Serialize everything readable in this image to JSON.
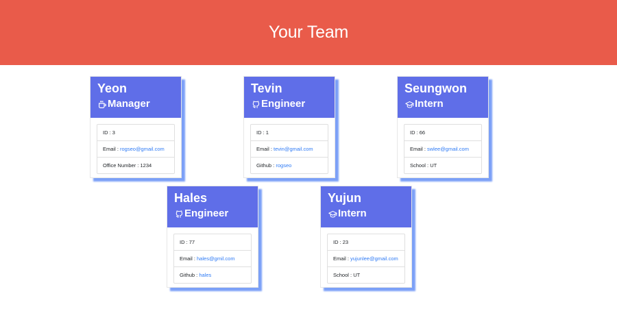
{
  "header": {
    "title": "Your Team"
  },
  "cards": [
    {
      "name": "Yeon",
      "role": "Manager",
      "icon": "coffee-mug-icon",
      "id_label": "ID :",
      "id": "3",
      "email_label": "Email :",
      "email": "rogseo@gmail.com",
      "extra_label": "Office Number :",
      "extra": "1234"
    },
    {
      "name": "Tevin",
      "role": "Engineer",
      "icon": "github-icon",
      "id_label": "ID :",
      "id": "1",
      "email_label": "Email :",
      "email": "tevin@gmail.com",
      "extra_label": "Github :",
      "extra": "rogseo"
    },
    {
      "name": "Seungwon",
      "role": "Intern",
      "icon": "graduation-cap-icon",
      "id_label": "ID :",
      "id": "66",
      "email_label": "Email :",
      "email": "swlee@gmail.com",
      "extra_label": "School :",
      "extra": "UT"
    },
    {
      "name": "Hales",
      "role": "Engineer",
      "icon": "github-icon",
      "id_label": "ID :",
      "id": "77",
      "email_label": "Email :",
      "email": "hales@gmil.com",
      "extra_label": "Github :",
      "extra": "hales"
    },
    {
      "name": "Yujun",
      "role": "Intern",
      "icon": "graduation-cap-icon",
      "id_label": "ID :",
      "id": "23",
      "email_label": "Email :",
      "email": "yujunlee@gmail.com",
      "extra_label": "School :",
      "extra": "UT"
    }
  ],
  "colors": {
    "header_bg": "#e95b4a",
    "card_head_bg": "#5f6ee8",
    "card_shadow": "#7ba0f7",
    "link": "#2f7bf5"
  }
}
